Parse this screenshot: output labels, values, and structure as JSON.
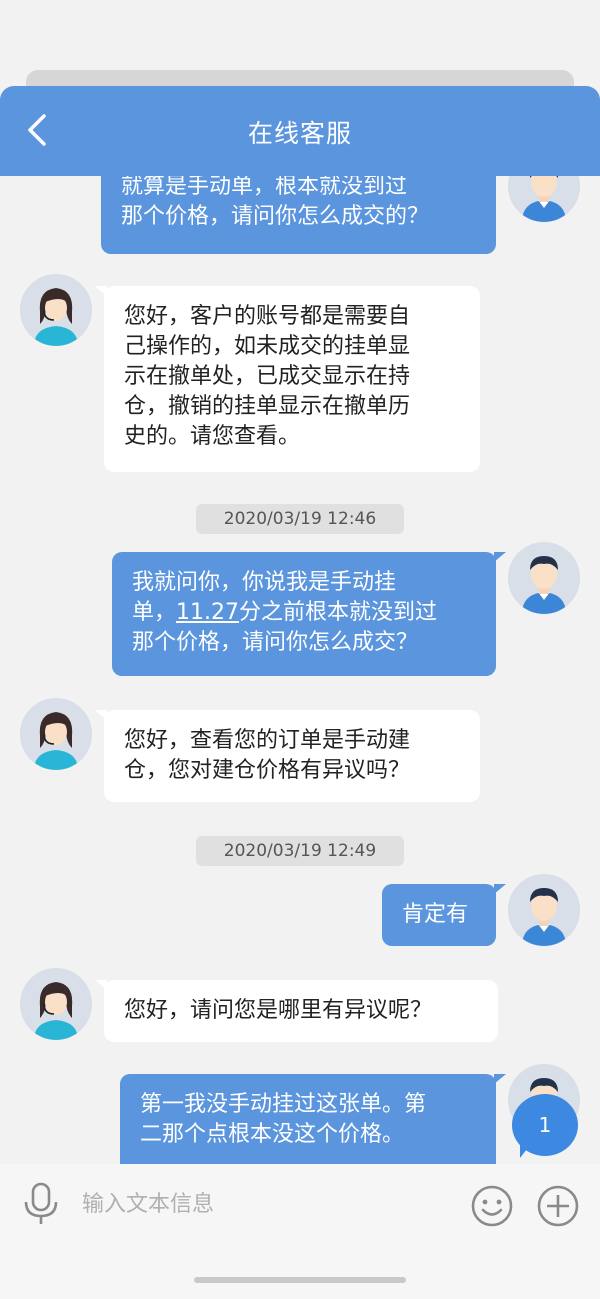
{
  "header": {
    "title": "在线客服"
  },
  "chat": {
    "msg1": {
      "lines": [
        "就算是手动单，根本就没到过",
        "那个价格，请问你怎么成交的？"
      ]
    },
    "msg2": {
      "lines": [
        "您好，客户的账号都是需要自",
        "己操作的，如未成交的挂单显",
        "示在撤单处，已成交显示在持",
        "仓，撤销的挂单显示在撤单历",
        "史的。请您查看。"
      ]
    },
    "ts1": "2020/03/19 12:46",
    "msg3": {
      "line1": "我就问你，你说我是手动挂",
      "line2_pre": "单，",
      "line2_link": "11.27",
      "line2_post": "分之前根本就没到过",
      "line3": "那个价格，请问你怎么成交？"
    },
    "msg4": {
      "lines": [
        "您好，查看您的订单是手动建",
        "仓，您对建仓价格有异议吗？"
      ]
    },
    "ts2": "2020/03/19 12:49",
    "msg5": {
      "lines": [
        "肯定有"
      ]
    },
    "msg6": {
      "lines": [
        "您好，请问您是哪里有异议呢？"
      ]
    },
    "msg7": {
      "lines": [
        "第一我没手动挂过这张单。第",
        "二那个点根本没这个价格。"
      ]
    }
  },
  "badge": {
    "count": "1"
  },
  "input": {
    "placeholder": "输入文本信息"
  },
  "colors": {
    "header": "#5a95de",
    "user_bubble": "#5a95de",
    "agent_bubble": "#ffffff",
    "background": "#f2f2f2"
  }
}
